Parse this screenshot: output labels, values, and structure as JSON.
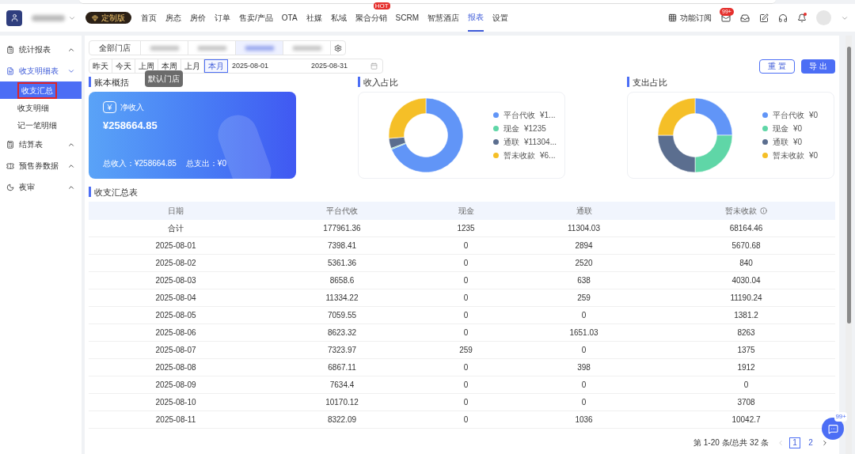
{
  "header": {
    "edition_badge": "定制版",
    "nav": [
      {
        "label": "首页",
        "selected": false
      },
      {
        "label": "房态",
        "selected": false
      },
      {
        "label": "房价",
        "selected": false
      },
      {
        "label": "订单",
        "selected": false
      },
      {
        "label": "售卖/产品",
        "selected": false
      },
      {
        "label": "OTA",
        "selected": false
      },
      {
        "label": "社媒",
        "selected": false
      },
      {
        "label": "私域",
        "selected": false
      },
      {
        "label": "聚合分销",
        "selected": false,
        "hot": "HOT"
      },
      {
        "label": "SCRM",
        "selected": false
      },
      {
        "label": "智慧酒店",
        "selected": false
      },
      {
        "label": "报表",
        "selected": true
      },
      {
        "label": "设置",
        "selected": false
      }
    ],
    "subscribe": "功能订阅",
    "message_count": "99+",
    "notification_dot": true
  },
  "sidebar": [
    {
      "label": "统计报表",
      "selected": false,
      "expanded": true
    },
    {
      "label": "收支明细表",
      "selected": true,
      "expanded": true,
      "children": [
        {
          "label": "收支汇总",
          "selected": true
        },
        {
          "label": "收支明细",
          "selected": false
        },
        {
          "label": "记一笔明细",
          "selected": false
        }
      ]
    },
    {
      "label": "结算表",
      "selected": false,
      "expanded": true
    },
    {
      "label": "预售券数据",
      "selected": false,
      "expanded": true
    },
    {
      "label": "夜审",
      "selected": false,
      "expanded": true
    }
  ],
  "stores": [
    {
      "kind": "text",
      "label": "全部门店",
      "selected": false
    },
    {
      "kind": "blurred",
      "selected": false
    },
    {
      "kind": "blurred",
      "selected": false
    },
    {
      "kind": "blurred",
      "selected": true
    },
    {
      "kind": "blurred",
      "selected": false
    }
  ],
  "tooltip": "默认门店",
  "quick_dates": [
    {
      "label": "昨天",
      "selected": false
    },
    {
      "label": "今天",
      "selected": false
    },
    {
      "label": "上周",
      "selected": false
    },
    {
      "label": "本周",
      "selected": false
    },
    {
      "label": "上月",
      "selected": false
    },
    {
      "label": "本月",
      "selected": true
    }
  ],
  "date_range": {
    "start": "2025-08-01",
    "end": "2025-08-31"
  },
  "buttons": {
    "reset": "重 置",
    "export": "导 出"
  },
  "summary": {
    "title": "账本概括",
    "label": "净收入",
    "amount": "¥258664.85",
    "income": "总收入：¥258664.85",
    "expense": "总支出：¥0"
  },
  "income_share": {
    "title": "收入占比",
    "legend": [
      {
        "amount": "¥1...",
        "color": "#6195f7"
      },
      {
        "amount": "¥1235",
        "color": "#5fd6a7"
      },
      {
        "amount": "¥11304...",
        "color": "#5b6e8f"
      },
      {
        "amount": "¥6...",
        "color": "#f5bf27"
      }
    ],
    "chart_data": {
      "type": "donut",
      "categories": [
        "平台代收",
        "现金",
        "通联",
        "暂未收款"
      ],
      "values": [
        68.8,
        0.48,
        4.37,
        26.35
      ]
    }
  },
  "expense_share": {
    "title": "支出占比",
    "legend": [
      {
        "label": "平台代收",
        "amount": "¥0",
        "color": "#6195f7"
      },
      {
        "label": "现金",
        "amount": "¥0",
        "color": "#5fd6a7"
      },
      {
        "label": "通联",
        "amount": "¥0",
        "color": "#5b6e8f"
      },
      {
        "label": "暂未收款",
        "amount": "¥0",
        "color": "#f5bf27"
      }
    ]
  },
  "table": {
    "title": "收支汇总表",
    "columns": [
      {
        "label": "日期",
        "hint_icon": false
      },
      {
        "label": "平台代收",
        "hint_icon": false
      },
      {
        "label": "现金",
        "hint_icon": false
      },
      {
        "label": "通联",
        "hint_icon": false
      },
      {
        "label": "暂未收款",
        "hint_icon": true
      }
    ],
    "rows": [
      [
        "合计",
        "177961.36",
        "1235",
        "11304.03",
        "68164.46"
      ],
      [
        "2025-08-01",
        "7398.41",
        "0",
        "2894",
        "5670.68"
      ],
      [
        "2025-08-02",
        "5361.36",
        "0",
        "2520",
        "840"
      ],
      [
        "2025-08-03",
        "8658.6",
        "0",
        "638",
        "4030.04"
      ],
      [
        "2025-08-04",
        "11334.22",
        "0",
        "259",
        "11190.24"
      ],
      [
        "2025-08-05",
        "7059.55",
        "0",
        "0",
        "1381.2"
      ],
      [
        "2025-08-06",
        "8623.32",
        "0",
        "1651.03",
        "8263"
      ],
      [
        "2025-08-07",
        "7323.97",
        "259",
        "0",
        "1375"
      ],
      [
        "2025-08-08",
        "6867.11",
        "0",
        "398",
        "1912"
      ],
      [
        "2025-08-09",
        "7634.4",
        "0",
        "0",
        "0"
      ],
      [
        "2025-08-10",
        "10170.12",
        "0",
        "0",
        "3708"
      ],
      [
        "2025-08-11",
        "8322.09",
        "0",
        "1036",
        "10042.7"
      ]
    ]
  },
  "pagination": {
    "summary": "第 1-20 条/总共 32 条",
    "pages": [
      {
        "label": "1",
        "selected": true
      },
      {
        "label": "2",
        "selected": false
      }
    ]
  },
  "chat_badge": "99+"
}
